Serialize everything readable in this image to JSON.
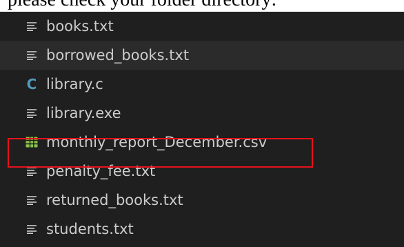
{
  "caption": "please check your folder directory:",
  "files": [
    {
      "name": "books.txt",
      "icon": "lines-icon"
    },
    {
      "name": "borrowed_books.txt",
      "icon": "lines-icon"
    },
    {
      "name": "library.c",
      "icon": "c-language-icon",
      "icon_text": "C"
    },
    {
      "name": "library.exe",
      "icon": "lines-icon"
    },
    {
      "name": "monthly_report_December.csv",
      "icon": "csv-table-icon"
    },
    {
      "name": "penalty_fee.txt",
      "icon": "lines-icon"
    },
    {
      "name": "returned_books.txt",
      "icon": "lines-icon"
    },
    {
      "name": "students.txt",
      "icon": "lines-icon"
    }
  ],
  "colors": {
    "background": "#1f1f1f",
    "hover_row": "#2b2b2b",
    "text": "#cccccc",
    "c_icon": "#519aba",
    "csv_icon": "#8bc34a",
    "highlight_border": "#e5121b"
  }
}
